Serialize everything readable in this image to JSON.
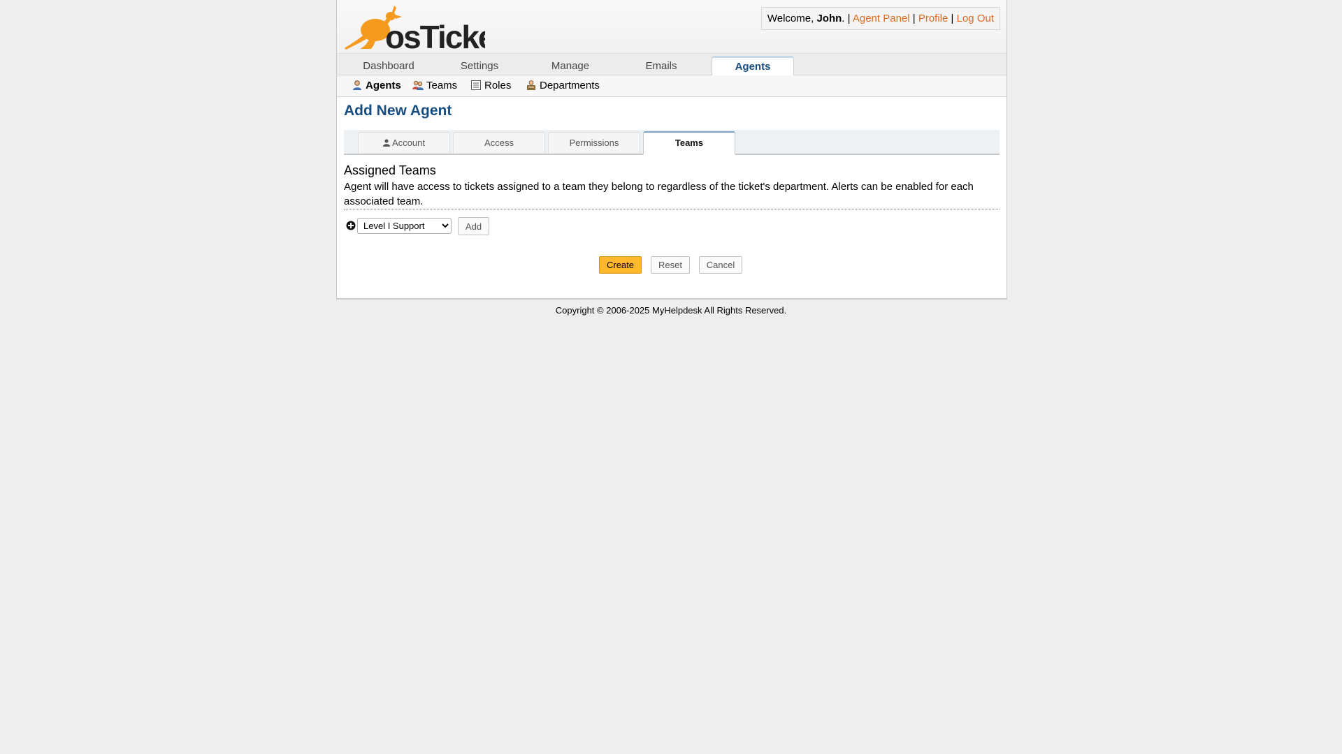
{
  "brand": {
    "logo_text": "osTicket"
  },
  "header": {
    "welcome_prefix": "Welcome, ",
    "user_name": "John",
    "welcome_suffix": ". |",
    "sep": "|",
    "agent_panel": "Agent Panel",
    "profile": "Profile",
    "logout": "Log Out"
  },
  "nav": {
    "tabs": [
      {
        "label": "Dashboard"
      },
      {
        "label": "Settings"
      },
      {
        "label": "Manage"
      },
      {
        "label": "Emails"
      },
      {
        "label": "Agents",
        "active": true
      }
    ]
  },
  "subnav": {
    "items": [
      {
        "label": "Agents",
        "icon": "agent-icon",
        "active": true
      },
      {
        "label": "Teams",
        "icon": "teams-icon"
      },
      {
        "label": "Roles",
        "icon": "roles-icon"
      },
      {
        "label": "Departments",
        "icon": "departments-icon"
      }
    ]
  },
  "page": {
    "title": "Add New Agent"
  },
  "form_tabs": [
    {
      "label": "Account",
      "icon": "user-icon"
    },
    {
      "label": "Access"
    },
    {
      "label": "Permissions"
    },
    {
      "label": "Teams",
      "active": true
    }
  ],
  "teams_section": {
    "title": "Assigned Teams",
    "description": "Agent will have access to tickets assigned to a team they belong to regardless of the ticket's department. Alerts can be enabled for each associated team.",
    "select_value": "Level I Support",
    "add_label": "Add"
  },
  "actions": {
    "create": "Create",
    "reset": "Reset",
    "cancel": "Cancel"
  },
  "footer": {
    "copyright": "Copyright © 2006-2025 MyHelpdesk All Rights Reserved."
  },
  "colors": {
    "accent_blue": "#184e81",
    "link_orange": "#e06a20",
    "create_button": "#fdb92b",
    "page_background": "#eeeeee"
  }
}
